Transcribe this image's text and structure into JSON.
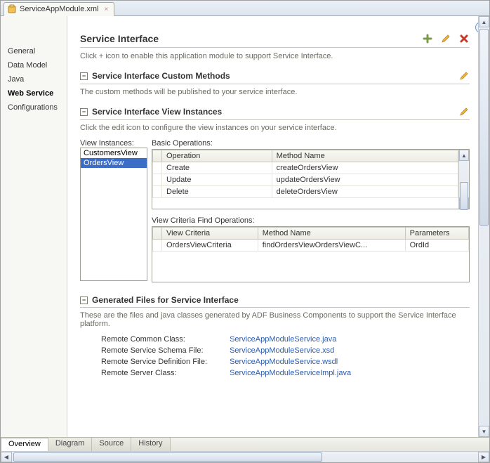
{
  "tab": {
    "title": "ServiceAppModule.xml"
  },
  "nav": {
    "items": [
      {
        "label": "General"
      },
      {
        "label": "Data Model"
      },
      {
        "label": "Java"
      },
      {
        "label": "Web Service"
      },
      {
        "label": "Configurations"
      }
    ]
  },
  "header": {
    "title": "Service Interface",
    "desc": "Click + icon to enable this application module to support Service Interface."
  },
  "custom_methods": {
    "title": "Service Interface Custom Methods",
    "desc": "The custom methods will be published to your service interface."
  },
  "view_instances": {
    "title": "Service Interface View Instances",
    "desc": "Click the edit icon to configure the view instances on your service interface.",
    "list_label": "View Instances:",
    "items": [
      {
        "label": "CustomersView"
      },
      {
        "label": "OrdersView"
      }
    ],
    "basic_ops_label": "Basic Operations:",
    "ops_columns": {
      "op": "Operation",
      "method": "Method Name"
    },
    "ops": [
      {
        "op": "Create",
        "method": "createOrdersView"
      },
      {
        "op": "Update",
        "method": "updateOrdersView"
      },
      {
        "op": "Delete",
        "method": "deleteOrdersView"
      }
    ],
    "criteria_label": "View Criteria Find Operations:",
    "criteria_columns": {
      "vc": "View Criteria",
      "method": "Method Name",
      "params": "Parameters"
    },
    "criteria": [
      {
        "vc": "OrdersViewCriteria",
        "method": "findOrdersViewOrdersViewC...",
        "params": "OrdId"
      }
    ]
  },
  "gen_files": {
    "title": "Generated Files for Service Interface",
    "desc": "These are the files and java classes generated by ADF Business Components to support the Service Interface platform.",
    "rows": [
      {
        "label": "Remote Common Class:",
        "file": "ServiceAppModuleService.java"
      },
      {
        "label": "Remote Service Schema File:",
        "file": "ServiceAppModuleService.xsd"
      },
      {
        "label": "Remote Service Definition File:",
        "file": "ServiceAppModuleService.wsdl"
      },
      {
        "label": "Remote Server Class:",
        "file": "ServiceAppModuleServiceImpl.java"
      }
    ]
  },
  "bottom_tabs": [
    {
      "label": "Overview"
    },
    {
      "label": "Diagram"
    },
    {
      "label": "Source"
    },
    {
      "label": "History"
    }
  ]
}
